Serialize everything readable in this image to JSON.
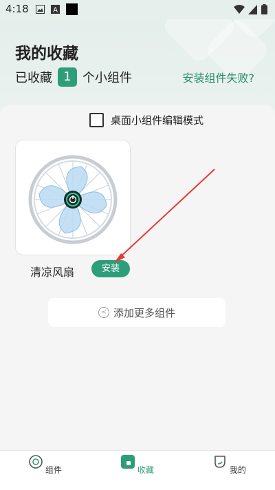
{
  "status_bar": {
    "time": "4:18"
  },
  "header": {
    "title": "我的收藏",
    "count_prefix": "已收藏",
    "count": "1",
    "count_suffix": "个小组件",
    "install_fail_link": "安装组件失败?"
  },
  "panel": {
    "edit_mode_label": "桌面小组件编辑模式",
    "widgets": [
      {
        "name": "清凉风扇",
        "install_label": "安装",
        "icon": "fan-icon"
      }
    ],
    "add_more_label": "添加更多组件"
  },
  "tabbar": {
    "tabs": [
      {
        "label": "组件",
        "icon": "widget-circle-icon"
      },
      {
        "label": "收藏",
        "icon": "favorites-icon",
        "active": true
      },
      {
        "label": "我的",
        "icon": "profile-leaf-icon"
      }
    ]
  },
  "colors": {
    "accent": "#2e9e7a",
    "annotation_arrow": "#e53935"
  }
}
